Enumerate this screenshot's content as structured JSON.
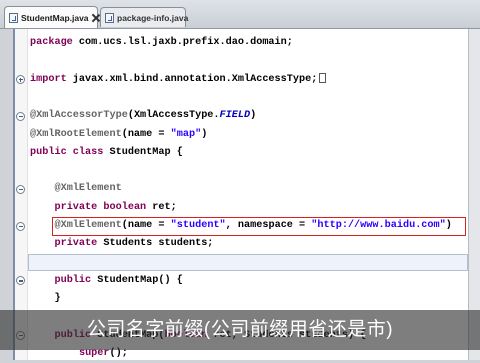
{
  "window": {
    "tabs": [
      {
        "label": "StudentMap.java",
        "active": true
      },
      {
        "label": "package-info.java",
        "active": false
      }
    ]
  },
  "colors": {
    "keyword": "#7f0055",
    "annotation": "#646464",
    "string": "#2a00ff",
    "constant": "#0000c0",
    "text": "#000000",
    "current_line": "#eef3fb",
    "highlight_box": "#d8221e"
  },
  "editor": {
    "lines": [
      {
        "indent": 0,
        "tokens": [
          {
            "t": "package",
            "k": "kw"
          },
          {
            "t": " com.ucs.lsl.jaxb.prefix.dao.domain;",
            "k": "plain"
          }
        ]
      },
      {
        "indent": 0,
        "tokens": []
      },
      {
        "indent": 0,
        "fold": "plus",
        "folded_imports": true,
        "tokens": [
          {
            "t": "import",
            "k": "kw"
          },
          {
            "t": " javax.xml.bind.annotation.XmlAccessType;",
            "k": "plain"
          }
        ]
      },
      {
        "indent": 0,
        "tokens": []
      },
      {
        "indent": 0,
        "fold": "minus",
        "tokens": [
          {
            "t": "@XmlAccessorType",
            "k": "ann"
          },
          {
            "t": "(XmlAccessType.",
            "k": "plain"
          },
          {
            "t": "FIELD",
            "k": "const"
          },
          {
            "t": ")",
            "k": "plain"
          }
        ]
      },
      {
        "indent": 0,
        "tokens": [
          {
            "t": "@XmlRootElement",
            "k": "ann"
          },
          {
            "t": "(name = ",
            "k": "plain"
          },
          {
            "t": "\"map\"",
            "k": "str"
          },
          {
            "t": ")",
            "k": "plain"
          }
        ]
      },
      {
        "indent": 0,
        "tokens": [
          {
            "t": "public class",
            "k": "kw"
          },
          {
            "t": " StudentMap {",
            "k": "plain"
          }
        ]
      },
      {
        "indent": 0,
        "tokens": []
      },
      {
        "indent": 1,
        "fold": "minus",
        "tokens": [
          {
            "t": "@XmlElement",
            "k": "ann"
          }
        ]
      },
      {
        "indent": 1,
        "tokens": [
          {
            "t": "private boolean",
            "k": "kw"
          },
          {
            "t": " ret;",
            "k": "plain"
          }
        ]
      },
      {
        "indent": 1,
        "fold": "minus",
        "boxed": true,
        "tokens": [
          {
            "t": "@XmlElement",
            "k": "ann"
          },
          {
            "t": "(name = ",
            "k": "plain"
          },
          {
            "t": "\"student\"",
            "k": "str"
          },
          {
            "t": ", namespace = ",
            "k": "plain"
          },
          {
            "t": "\"http://www.baidu.com\"",
            "k": "str"
          },
          {
            "t": ")",
            "k": "plain"
          }
        ]
      },
      {
        "indent": 1,
        "tokens": [
          {
            "t": "private",
            "k": "kw"
          },
          {
            "t": " Students students;",
            "k": "plain"
          }
        ]
      },
      {
        "indent": 1,
        "current": true,
        "tokens": []
      },
      {
        "indent": 1,
        "fold": "minus",
        "tokens": [
          {
            "t": "public",
            "k": "kw"
          },
          {
            "t": " StudentMap() {",
            "k": "plain"
          }
        ]
      },
      {
        "indent": 1,
        "tokens": [
          {
            "t": "}",
            "k": "plain"
          }
        ]
      },
      {
        "indent": 0,
        "tokens": []
      },
      {
        "indent": 1,
        "fold": "minus",
        "tokens": [
          {
            "t": "public",
            "k": "kw"
          },
          {
            "t": " StudentMap(",
            "k": "plain"
          },
          {
            "t": "boolean",
            "k": "kw"
          },
          {
            "t": " ret, Students students) {",
            "k": "plain"
          }
        ]
      },
      {
        "indent": 2,
        "tokens": [
          {
            "t": "super",
            "k": "kw"
          },
          {
            "t": "();",
            "k": "plain"
          }
        ]
      }
    ]
  },
  "caption": "公司名字前缀(公司前缀用省还是市)"
}
